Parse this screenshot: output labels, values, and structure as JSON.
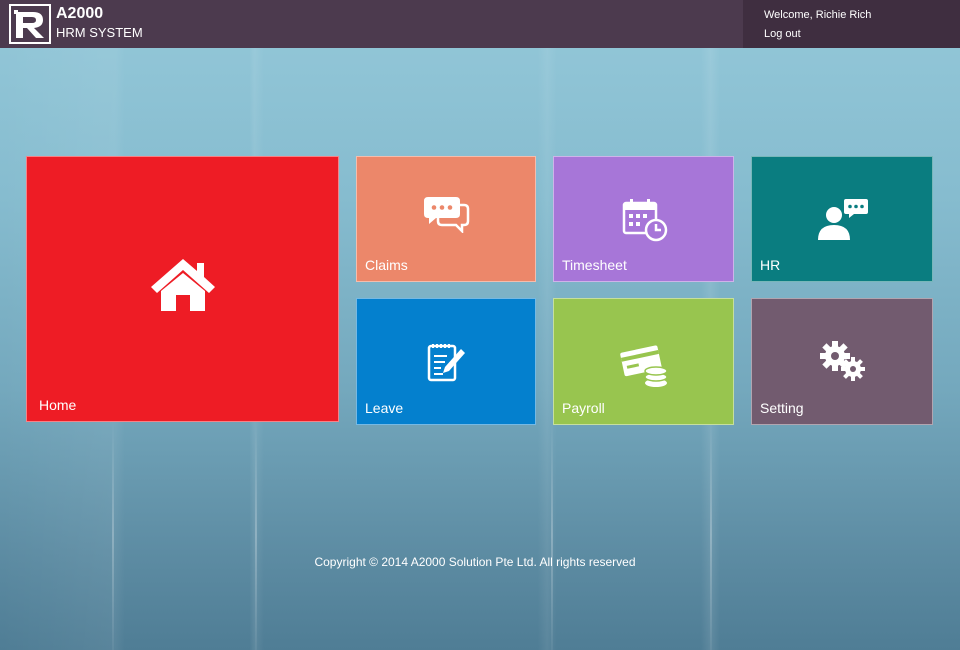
{
  "header": {
    "brand_title": "A2000",
    "brand_subtitle": "HRM SYSTEM",
    "welcome_text": "Welcome, Richie Rich",
    "logout_label": "Log out",
    "bar_color": "#4c3a4e"
  },
  "tiles": [
    {
      "label": "Home",
      "color": "#ee1c25",
      "icon": "home-icon"
    },
    {
      "label": "Claims",
      "color": "#ec876a",
      "icon": "chat-bubbles-icon"
    },
    {
      "label": "Timesheet",
      "color": "#a776d8",
      "icon": "calendar-clock-icon"
    },
    {
      "label": "HR",
      "color": "#0a7d80",
      "icon": "user-chat-icon"
    },
    {
      "label": "Leave",
      "color": "#0480ce",
      "icon": "clipboard-pen-icon"
    },
    {
      "label": "Payroll",
      "color": "#98c54f",
      "icon": "card-coins-icon"
    },
    {
      "label": "Setting",
      "color": "#725b6f",
      "icon": "gears-icon"
    }
  ],
  "footer": {
    "copyright": "Copyright © 2014 A2000 Solution Pte Ltd. All rights reserved"
  }
}
